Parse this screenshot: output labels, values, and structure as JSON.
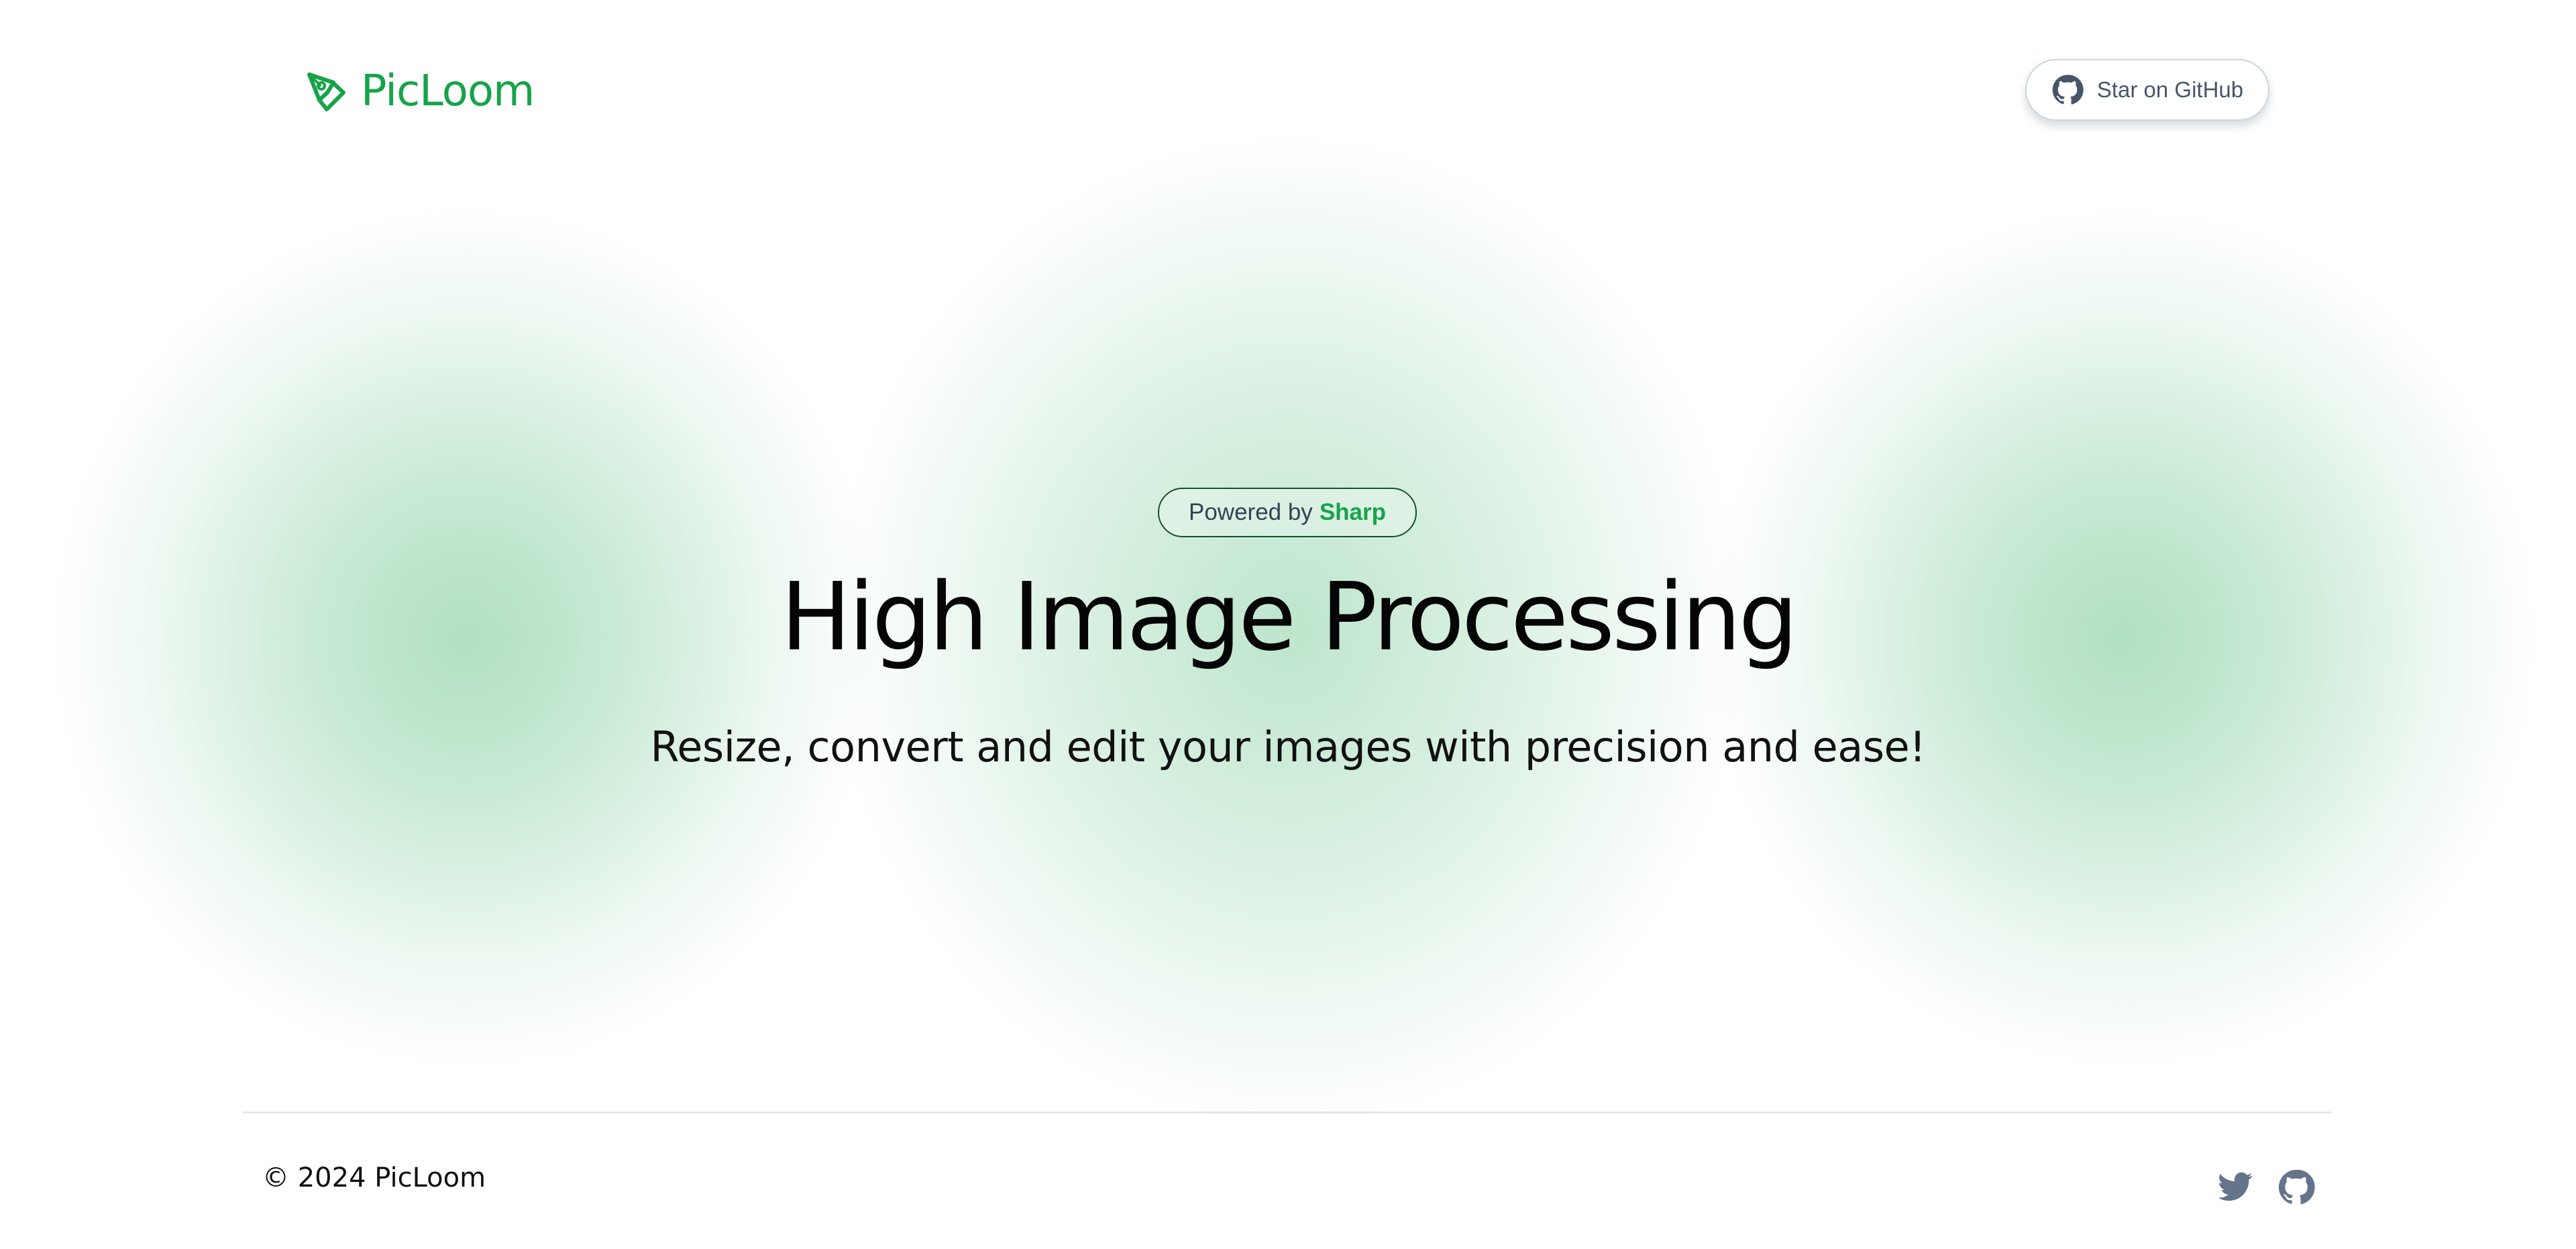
{
  "brand": {
    "name": "PicLoom",
    "icon": "pen-tool-icon",
    "accent_color": "#16a34a"
  },
  "header": {
    "github_button_label": "Star on GitHub",
    "github_icon": "github-icon"
  },
  "hero": {
    "powered_prefix": "Powered by",
    "powered_brand": "Sharp",
    "title": "High Image Processing",
    "subtitle": "Resize, convert and edit your images with precision and ease!"
  },
  "footer": {
    "copyright": "© 2024 PicLoom",
    "social_icons": [
      "twitter-icon",
      "github-icon"
    ]
  },
  "colors": {
    "background": "#ffffff",
    "glow": "#16a34a",
    "text": "#050505",
    "muted_icon": "#64748b",
    "divider": "#e5e7eb"
  }
}
